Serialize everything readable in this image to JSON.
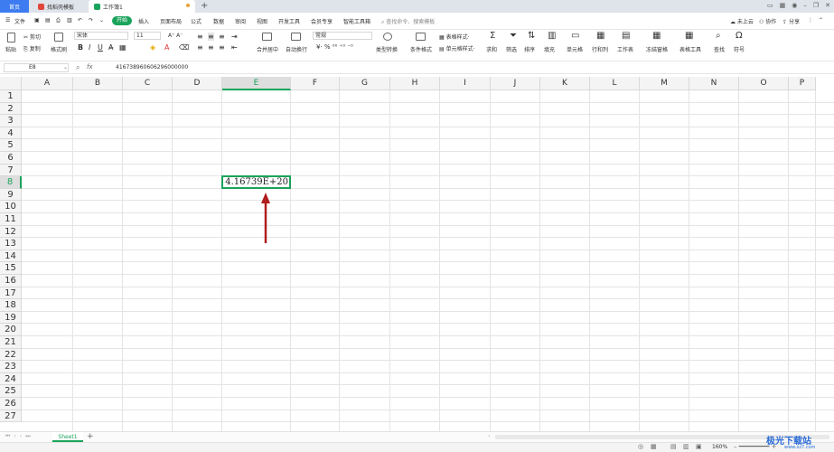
{
  "tabs": {
    "home": "首页",
    "template": "找稻壳模板",
    "book": "工作簿1"
  },
  "menu": {
    "file": "文件",
    "items": [
      "开始",
      "插入",
      "页面布局",
      "公式",
      "数据",
      "审阅",
      "视图",
      "开发工具",
      "会员专享",
      "智能工具箱"
    ],
    "search": "查找命令、搜索模板",
    "cloud": "未上云",
    "collab": "协作",
    "share": "分享"
  },
  "toolbar": {
    "cut": "剪切",
    "copy": "复制",
    "paste": "粘贴",
    "format_painter": "格式刷",
    "font": "宋体",
    "font_size": "11",
    "merge": "合并居中",
    "wrap": "自动换行",
    "number_format": "常规",
    "convert": "类型转换",
    "cond_format": "条件格式",
    "table_style": "表格样式",
    "cell_style": "单元格样式",
    "sum": "求和",
    "filter": "筛选",
    "sort": "排序",
    "fill": "填充",
    "cell": "单元格",
    "rowcol": "行和列",
    "sheet": "工作表",
    "freeze": "冻结窗格",
    "tools": "表格工具",
    "find": "查找",
    "symbol": "符号"
  },
  "formula_bar": {
    "name_box": "E8",
    "fx": "fx",
    "formula": "416738960606296000000"
  },
  "grid": {
    "columns": [
      "A",
      "B",
      "C",
      "D",
      "E",
      "F",
      "G",
      "H",
      "I",
      "J",
      "K",
      "L",
      "M",
      "N",
      "O",
      "P"
    ],
    "rows": [
      "1",
      "2",
      "3",
      "4",
      "5",
      "6",
      "7",
      "8",
      "9",
      "10",
      "11",
      "12",
      "13",
      "14",
      "15",
      "16",
      "17",
      "18",
      "19",
      "20",
      "21",
      "22",
      "23",
      "24",
      "25",
      "26",
      "27"
    ],
    "active_col": "E",
    "active_row": "8",
    "active_value": "4.16739E+20"
  },
  "sheets": [
    "Sheet1"
  ],
  "status": {
    "zoom": "160%"
  },
  "watermark": {
    "name": "极光下载站",
    "url": "www.xz7.com"
  },
  "colors": {
    "accent": "#1aa35b",
    "tab_blue": "#3d7cf0",
    "arrow": "#b01e1e"
  }
}
